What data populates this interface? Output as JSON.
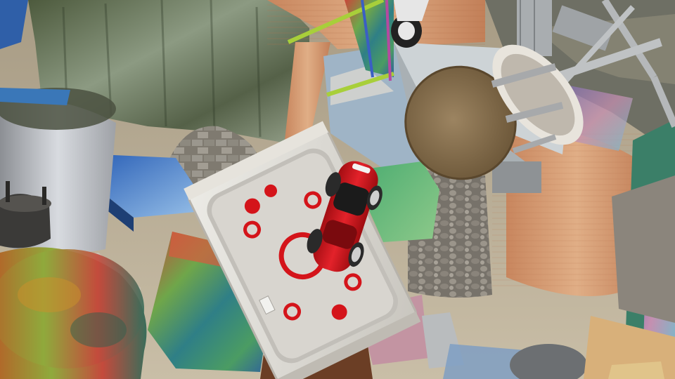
{
  "scene": {
    "kind": "rendered-3d-clutter",
    "objects": [
      {
        "name": "air-hockey-table",
        "color": "#d9d4cb"
      },
      {
        "name": "red-toy-car",
        "color": "#d4141a"
      },
      {
        "name": "round-bar-stool",
        "color": "#8a7151"
      },
      {
        "name": "folding-chair",
        "color": "#b9c2c6"
      },
      {
        "name": "colorful-stool-legs",
        "color": "#a8cf3a"
      },
      {
        "name": "toy-car-wheel",
        "color": "#e8e8e8"
      }
    ],
    "palette": {
      "sand": "#b7ab93",
      "wood": "#d49b73",
      "stone": "#8b8377",
      "sky": "#5e8fc4"
    }
  }
}
